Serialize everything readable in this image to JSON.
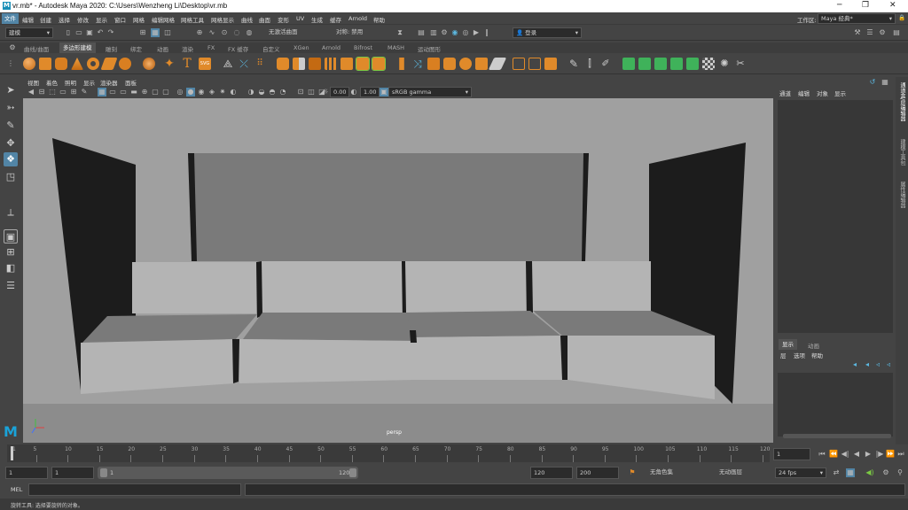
{
  "window": {
    "title": "vr.mb* - Autodesk Maya 2020: C:\\Users\\Wenzheng Li\\Desktop\\vr.mb"
  },
  "menubar": {
    "items": [
      "文件",
      "编辑",
      "创建",
      "选择",
      "修改",
      "显示",
      "窗口",
      "网格",
      "编辑网格",
      "网格工具",
      "网格显示",
      "曲线",
      "曲面",
      "变形",
      "UV",
      "生成",
      "缓存",
      "Arnold",
      "帮助"
    ],
    "workspace_label": "工作区:",
    "workspace_value": "Maya 经典*"
  },
  "statusline": {
    "mode": "建模",
    "live_surface": "无激活曲面",
    "symmetry": "对称: 禁用",
    "login": "登录"
  },
  "shelf": {
    "tabs": [
      "曲线/曲面",
      "多边形建模",
      "雕刻",
      "绑定",
      "动画",
      "渲染",
      "FX",
      "FX 缓存",
      "自定义",
      "XGen",
      "Arnold",
      "Bifrost",
      "MASH",
      "运动图形"
    ],
    "active_tab": "多边形建模"
  },
  "panel": {
    "menus": [
      "视图",
      "着色",
      "照明",
      "显示",
      "渲染器",
      "面板"
    ],
    "exposure": "0.00",
    "gamma": "1.00",
    "colorspace": "sRGB gamma",
    "camera_label": "persp"
  },
  "channelbox": {
    "menus": [
      "通道",
      "编辑",
      "对象",
      "显示"
    ]
  },
  "layers": {
    "tabs": [
      "显示",
      "动画"
    ],
    "menus": [
      "层",
      "选项",
      "帮助"
    ]
  },
  "sidetabs": [
    "通道盒/层编辑器",
    "建模工具包",
    "属性编辑器"
  ],
  "timeslider": {
    "ticks": [
      "5",
      "10",
      "15",
      "20",
      "25",
      "30",
      "35",
      "40",
      "45",
      "50",
      "55",
      "60",
      "65",
      "70",
      "75",
      "80",
      "85",
      "90",
      "95",
      "100",
      "105",
      "110",
      "115",
      "120"
    ],
    "current_frame": "1",
    "tick_start": "1"
  },
  "range": {
    "start": "1",
    "playback_start": "1",
    "slider_start": "1",
    "slider_end": "120",
    "playback_end": "120",
    "end": "200",
    "character_set": "无角色集",
    "anim_layer": "无动画层",
    "fps": "24 fps"
  },
  "cmdline": {
    "label": "MEL"
  },
  "helpline": {
    "text": "旋转工具: 选择要旋转的对象。"
  }
}
